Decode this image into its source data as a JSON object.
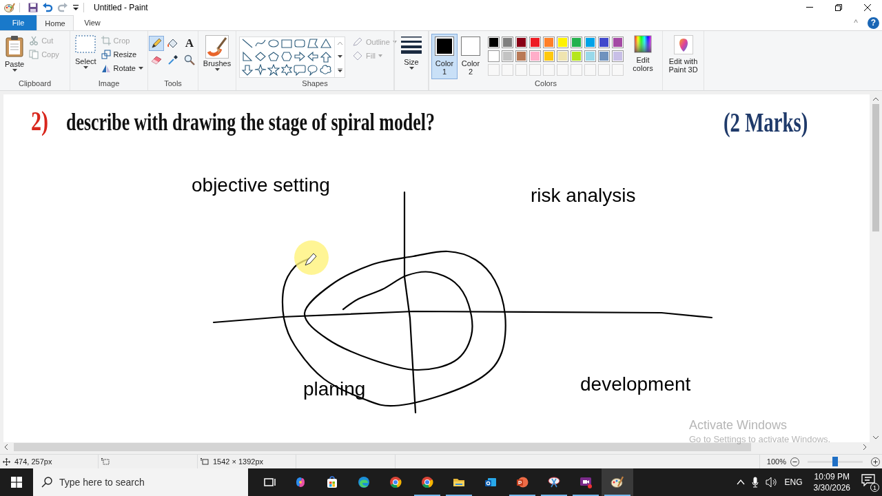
{
  "window": {
    "title": "Untitled - Paint",
    "collapse_glyph": "^",
    "help_glyph": "?"
  },
  "menu_tabs": [
    {
      "label": "File",
      "kind": "file",
      "selected": false
    },
    {
      "label": "Home",
      "kind": "tab",
      "selected": true
    },
    {
      "label": "View",
      "kind": "tab",
      "selected": false
    }
  ],
  "clipboard": {
    "title": "Clipboard",
    "paste": "Paste",
    "cut": {
      "label": "Cut",
      "disabled": true
    },
    "copy": {
      "label": "Copy",
      "disabled": true
    }
  },
  "image": {
    "title": "Image",
    "select": "Select",
    "crop": {
      "label": "Crop",
      "disabled": true
    },
    "resize": {
      "label": "Resize",
      "disabled": false
    },
    "rotate": {
      "label": "Rotate",
      "disabled": false
    }
  },
  "tools": {
    "title": "Tools",
    "items": [
      {
        "kind": "pencil",
        "selected": true
      },
      {
        "kind": "fill",
        "selected": false
      },
      {
        "kind": "text",
        "glyph": "A",
        "selected": false
      },
      {
        "kind": "eraser",
        "selected": false
      },
      {
        "kind": "picker",
        "selected": false
      },
      {
        "kind": "magnifier",
        "selected": false
      }
    ]
  },
  "brushes": {
    "label": "Brushes"
  },
  "shapes": {
    "title": "Shapes",
    "outline": {
      "label": "Outline",
      "disabled": true
    },
    "fill": {
      "label": "Fill",
      "disabled": true
    }
  },
  "size": {
    "label": "Size"
  },
  "colors": {
    "title": "Colors",
    "slots": [
      {
        "label": "Color 1",
        "color": "#000000",
        "selected": true
      },
      {
        "label": "Color 2",
        "color": "#ffffff",
        "selected": false
      }
    ],
    "palette": [
      {
        "color": "#000000"
      },
      {
        "color": "#7f7f7f"
      },
      {
        "color": "#880015"
      },
      {
        "color": "#ed1c24"
      },
      {
        "color": "#ff7f27"
      },
      {
        "color": "#fff200"
      },
      {
        "color": "#22b14c"
      },
      {
        "color": "#00a2e8"
      },
      {
        "color": "#3f48cc"
      },
      {
        "color": "#a349a4"
      },
      {
        "color": "#ffffff"
      },
      {
        "color": "#c3c3c3"
      },
      {
        "color": "#b97a57"
      },
      {
        "color": "#ffaec9"
      },
      {
        "color": "#ffc90e"
      },
      {
        "color": "#efe4b0"
      },
      {
        "color": "#b5e61d"
      },
      {
        "color": "#99d9ea"
      },
      {
        "color": "#7092be"
      },
      {
        "color": "#c8bfe7"
      }
    ],
    "edit_colors": "Edit colors"
  },
  "paint3d": {
    "label": "Edit with Paint 3D"
  },
  "canvas": {
    "heading": {
      "number": "2)",
      "text": "describe with drawing the stage of spiral model?",
      "marks": "(2 Marks)"
    },
    "labels": [
      {
        "text": "objective setting"
      },
      {
        "text": "risk analysis"
      },
      {
        "text": "planing"
      },
      {
        "text": "development"
      }
    ]
  },
  "activation": {
    "title": "Activate Windows",
    "hint": "Go to Settings to activate Windows."
  },
  "status_bar": {
    "cursor_position": "474, 257px",
    "image_size": "1542 × 1392px",
    "zoom": {
      "reading": "100%",
      "level": 0.5
    }
  },
  "taskbar": {
    "search_placeholder": "Type here to search",
    "apps": [
      {
        "kind": "task-view",
        "running": false,
        "active": false
      },
      {
        "kind": "copilot",
        "running": false,
        "active": false
      },
      {
        "kind": "store",
        "running": false,
        "active": false
      },
      {
        "kind": "edge",
        "running": false,
        "active": false
      },
      {
        "kind": "chrome",
        "running": false,
        "active": false
      },
      {
        "kind": "chrome",
        "running": true,
        "active": false
      },
      {
        "kind": "explorer",
        "running": true,
        "active": false
      },
      {
        "kind": "outlook",
        "running": false,
        "active": false
      },
      {
        "kind": "powerpoint",
        "running": true,
        "active": false
      },
      {
        "kind": "snipping",
        "running": true,
        "active": false
      },
      {
        "kind": "clipchamp",
        "running": true,
        "active": false
      },
      {
        "kind": "paint",
        "running": true,
        "active": true
      }
    ],
    "language": "ENG",
    "time": "10:09 PM",
    "date": "3/30/2026",
    "notification_count": "1"
  }
}
